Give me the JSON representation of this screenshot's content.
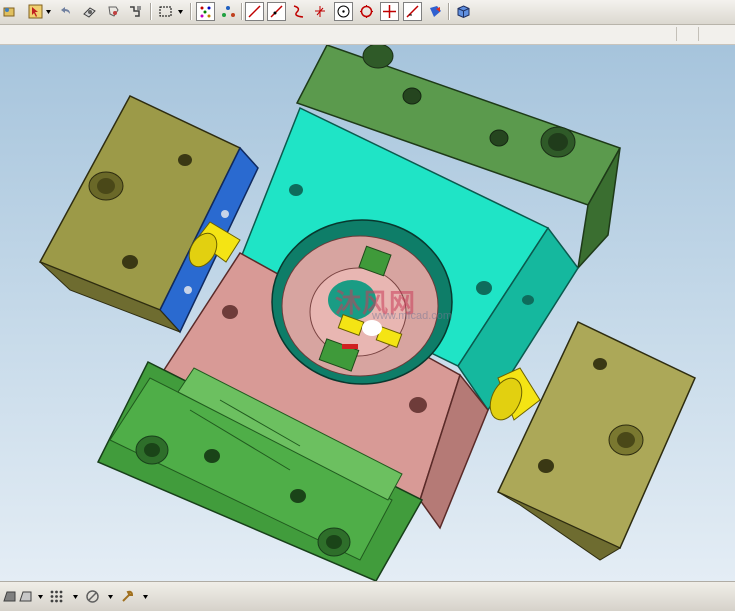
{
  "app": {
    "accent": "#0a246a"
  },
  "toolbar_top": {
    "icons": [
      "assembly-icon",
      "cursor-select-icon",
      "undo-arrow-icon",
      "rotate-part-icon",
      "snap-icon",
      "drag-icon",
      "box-select-icon",
      "point-select-icon",
      "node-select-icon",
      "line-icon",
      "tangent-line-icon",
      "curve-icon",
      "axis-icon",
      "circle-center-icon",
      "circle-quadrant-icon",
      "crosshair-icon",
      "diagonal-line-icon",
      "view-icon",
      "3d-cube-icon"
    ]
  },
  "viewport": {
    "colors": {
      "top_plate": "#5a9a4c",
      "cavity_block": "#1de6c8",
      "core_block": "#d89a96",
      "left_slider": "#9c9a48",
      "right_slider": "#aca858",
      "bottom_plate": "#3f9a3a",
      "cylinder": "#f4e414",
      "left_side_blue": "#2a6ad0"
    },
    "watermark": {
      "logo": "沐风网",
      "url": "www.mfcad.com"
    }
  },
  "toolbar_bottom": {
    "icons": [
      "shaded-view-icon",
      "wireframe-view-icon",
      "points-icon",
      "no-entry-icon",
      "tools-icon"
    ]
  }
}
